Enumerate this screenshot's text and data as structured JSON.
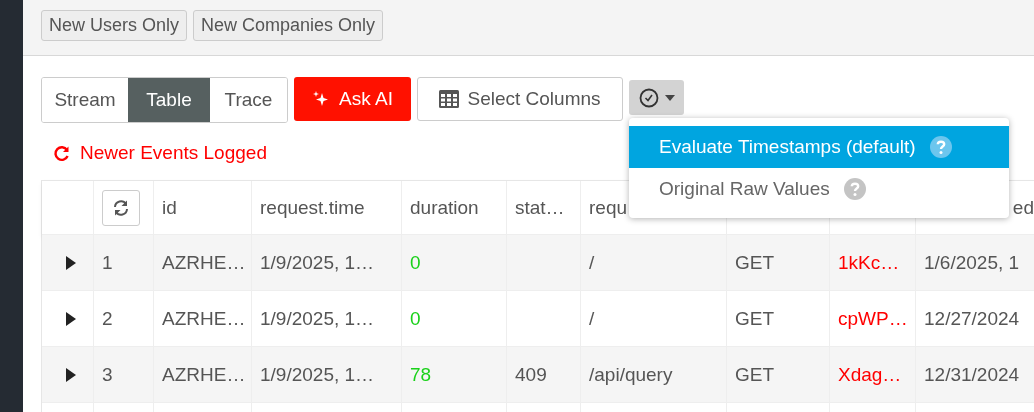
{
  "filters": [
    {
      "label": "New Users Only"
    },
    {
      "label": "New Companies Only"
    }
  ],
  "view_tabs": [
    {
      "label": "Stream",
      "selected": false
    },
    {
      "label": "Table",
      "selected": true
    },
    {
      "label": "Trace",
      "selected": false
    }
  ],
  "ask_ai": {
    "label": "Ask AI"
  },
  "select_columns": {
    "label": "Select Columns"
  },
  "time_menu": {
    "expanded": true,
    "options": [
      {
        "label": "Evaluate Timestamps (default)",
        "selected": true
      },
      {
        "label": "Original Raw Values",
        "selected": false
      }
    ]
  },
  "notice": {
    "text": "Newer Events Logged"
  },
  "table": {
    "columns": [
      {
        "kind": "text"
      },
      {
        "header": "id",
        "kind": "text"
      },
      {
        "header": "request.time",
        "kind": "text"
      },
      {
        "header": "duration",
        "kind": "good"
      },
      {
        "header": "stat…",
        "kind": "text"
      },
      {
        "header": "requ",
        "kind": "text"
      },
      {
        "kind": "text"
      },
      {
        "kind": "alert"
      },
      {
        "header": "ed",
        "kind": "text"
      }
    ],
    "rows": [
      {
        "cells": [
          "1",
          "AZRHE…",
          "1/9/2025, 1…",
          "0",
          null,
          "/",
          "GET",
          "1kKc…",
          "1/6/2025, 1"
        ]
      },
      {
        "cells": [
          "2",
          "AZRHE…",
          "1/9/2025, 1…",
          "0",
          null,
          "/",
          "GET",
          "cpWP…",
          "12/27/2024"
        ]
      },
      {
        "cells": [
          "3",
          "AZRHE…",
          "1/9/2025, 1…",
          "78",
          "409",
          "/api/query",
          "GET",
          "Xdag…",
          "12/31/2024"
        ]
      }
    ]
  }
}
